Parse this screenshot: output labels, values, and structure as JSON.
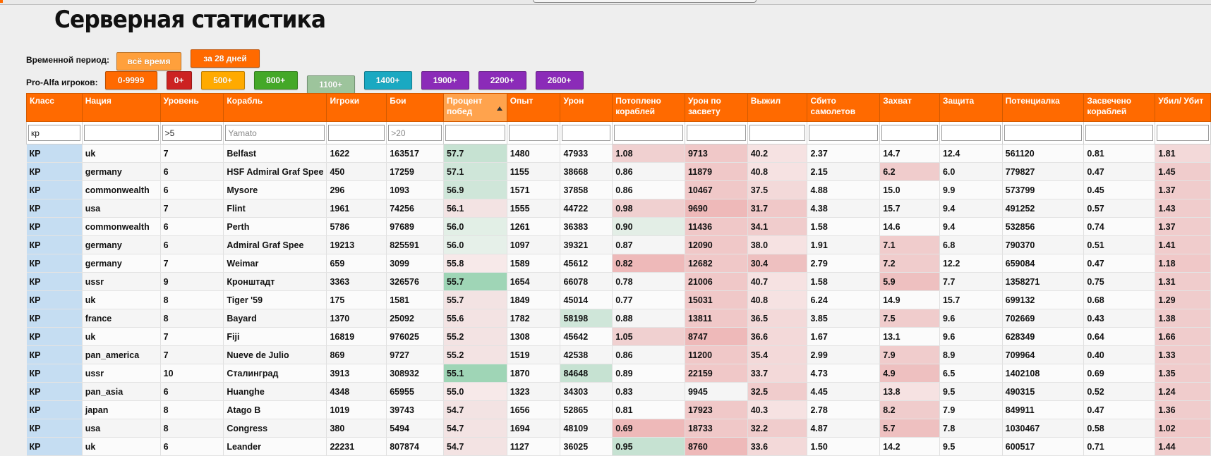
{
  "title": "Серверная статистика",
  "period": {
    "label": "Временной период:",
    "buttons": [
      {
        "label": "всё время",
        "color": "#ffa03c"
      },
      {
        "label": "за 28 дней",
        "color": "#ff6a00"
      }
    ]
  },
  "players": {
    "label": "Pro-Alfa игроков:",
    "buttons": [
      {
        "label": "0-9999",
        "color": "#ff6a00"
      },
      {
        "label": "0+",
        "color": "#cc2222"
      },
      {
        "label": "500+",
        "color": "#ffaa00"
      },
      {
        "label": "800+",
        "color": "#44a828"
      },
      {
        "label": "1100+",
        "color": "#9dc49c"
      },
      {
        "label": "1400+",
        "color": "#1aa9c2"
      },
      {
        "label": "1900+",
        "color": "#8b2bb8"
      },
      {
        "label": "2200+",
        "color": "#8b2bb8"
      },
      {
        "label": "2600+",
        "color": "#8b2bb8"
      }
    ]
  },
  "columns": [
    "Класс",
    "Нация",
    "Уровень",
    "Корабль",
    "Игроки",
    "Бои",
    "Процент побед",
    "Опыт",
    "Урон",
    "Потоплено кораблей",
    "Урон по засвету",
    "Выжил",
    "Сбито самолетов",
    "Захват",
    "Защита",
    "Потенциалка",
    "Засвечено кораблей",
    "Убил/ Убит"
  ],
  "sorted_column": 6,
  "filters": {
    "values": [
      "кр",
      "",
      ">5",
      "",
      "",
      "",
      "",
      "",
      "",
      "",
      "",
      "",
      "",
      "",
      "",
      "",
      "",
      ""
    ],
    "placeholders": [
      "",
      "",
      "",
      "Yamato",
      "",
      ">20",
      "",
      "",
      "",
      "",
      "",
      "",
      "",
      "",
      "",
      "",
      "",
      ""
    ]
  },
  "rows": [
    [
      "КР",
      "uk",
      "7",
      "Belfast",
      "1622",
      "163517",
      "57.7",
      "1480",
      "47933",
      "1.08",
      "9713",
      "40.2",
      "2.37",
      "14.7",
      "12.4",
      "561120",
      "0.81",
      "1.81"
    ],
    [
      "КР",
      "germany",
      "6",
      "HSF Admiral Graf Spee",
      "450",
      "17259",
      "57.1",
      "1155",
      "38668",
      "0.86",
      "11879",
      "40.8",
      "2.15",
      "6.2",
      "6.0",
      "779827",
      "0.47",
      "1.45"
    ],
    [
      "КР",
      "commonwealth",
      "6",
      "Mysore",
      "296",
      "1093",
      "56.9",
      "1571",
      "37858",
      "0.86",
      "10467",
      "37.5",
      "4.88",
      "15.0",
      "9.9",
      "573799",
      "0.45",
      "1.37"
    ],
    [
      "КР",
      "usa",
      "7",
      "Flint",
      "1961",
      "74256",
      "56.1",
      "1555",
      "44722",
      "0.98",
      "9690",
      "31.7",
      "4.38",
      "15.7",
      "9.4",
      "491252",
      "0.57",
      "1.43"
    ],
    [
      "КР",
      "commonwealth",
      "6",
      "Perth",
      "5786",
      "97689",
      "56.0",
      "1261",
      "36383",
      "0.90",
      "11436",
      "34.1",
      "1.58",
      "14.6",
      "9.4",
      "532856",
      "0.74",
      "1.37"
    ],
    [
      "КР",
      "germany",
      "6",
      "Admiral Graf Spee",
      "19213",
      "825591",
      "56.0",
      "1097",
      "39321",
      "0.87",
      "12090",
      "38.0",
      "1.91",
      "7.1",
      "6.8",
      "790370",
      "0.51",
      "1.41"
    ],
    [
      "КР",
      "germany",
      "7",
      "Weimar",
      "659",
      "3099",
      "55.8",
      "1589",
      "45612",
      "0.82",
      "12682",
      "30.4",
      "2.79",
      "7.2",
      "12.2",
      "659084",
      "0.47",
      "1.18"
    ],
    [
      "КР",
      "ussr",
      "9",
      "Кронштадт",
      "3363",
      "326576",
      "55.7",
      "1654",
      "66078",
      "0.78",
      "21006",
      "40.7",
      "1.58",
      "5.9",
      "7.7",
      "1358271",
      "0.75",
      "1.31"
    ],
    [
      "КР",
      "uk",
      "8",
      "Tiger '59",
      "175",
      "1581",
      "55.7",
      "1849",
      "45014",
      "0.77",
      "15031",
      "40.8",
      "6.24",
      "14.9",
      "15.7",
      "699132",
      "0.68",
      "1.29"
    ],
    [
      "КР",
      "france",
      "8",
      "Bayard",
      "1370",
      "25092",
      "55.6",
      "1782",
      "58198",
      "0.88",
      "13811",
      "36.5",
      "3.85",
      "7.5",
      "9.6",
      "702669",
      "0.43",
      "1.38"
    ],
    [
      "КР",
      "uk",
      "7",
      "Fiji",
      "16819",
      "976025",
      "55.2",
      "1308",
      "45642",
      "1.05",
      "8747",
      "36.6",
      "1.67",
      "13.1",
      "9.6",
      "628349",
      "0.64",
      "1.66"
    ],
    [
      "КР",
      "pan_america",
      "7",
      "Nueve de Julio",
      "869",
      "9727",
      "55.2",
      "1519",
      "42538",
      "0.86",
      "11200",
      "35.4",
      "2.99",
      "7.9",
      "8.9",
      "709964",
      "0.40",
      "1.33"
    ],
    [
      "КР",
      "ussr",
      "10",
      "Сталинград",
      "3913",
      "308932",
      "55.1",
      "1870",
      "84648",
      "0.89",
      "22159",
      "33.7",
      "4.73",
      "4.9",
      "6.5",
      "1402108",
      "0.69",
      "1.35"
    ],
    [
      "КР",
      "pan_asia",
      "6",
      "Huanghe",
      "4348",
      "65955",
      "55.0",
      "1323",
      "34303",
      "0.83",
      "9945",
      "32.5",
      "4.45",
      "13.8",
      "9.5",
      "490315",
      "0.52",
      "1.24"
    ],
    [
      "КР",
      "japan",
      "8",
      "Atago B",
      "1019",
      "39743",
      "54.7",
      "1656",
      "52865",
      "0.81",
      "17923",
      "40.3",
      "2.78",
      "8.2",
      "7.9",
      "849911",
      "0.47",
      "1.36"
    ],
    [
      "КР",
      "usa",
      "8",
      "Congress",
      "380",
      "5494",
      "54.7",
      "1694",
      "48109",
      "0.69",
      "18733",
      "32.2",
      "4.87",
      "5.7",
      "7.8",
      "1030467",
      "0.58",
      "1.02"
    ],
    [
      "КР",
      "uk",
      "6",
      "Leander",
      "22231",
      "807874",
      "54.7",
      "1127",
      "36025",
      "0.95",
      "8760",
      "33.6",
      "1.50",
      "14.2",
      "9.5",
      "600517",
      "0.71",
      "1.44"
    ]
  ],
  "cell_colors": {
    "win_rate": [
      "#c6e2d2",
      "#cfe6d9",
      "#cfe6d9",
      "#f3e3e3",
      "#e2efe6",
      "#e6f0e9",
      "#f7e9e9",
      "#9fd5b6",
      "#f3e3e3",
      "#f3e3e3",
      "#f3e3e3",
      "#f3e3e3",
      "#9fd5b6",
      "#f7e9e9",
      "#f3e3e3",
      "#f3e3e3",
      "#f3e3e3"
    ],
    "damage": [
      "",
      "",
      "",
      "",
      "",
      "",
      "",
      "",
      "",
      "#cfe6d9",
      "",
      "",
      "#c6e2d2",
      "",
      "",
      "",
      ""
    ],
    "kills": [
      "#f0d0d0",
      "",
      "",
      "#f0d0d0",
      "#e3eee6",
      "",
      "#eeb9b9",
      "",
      "",
      "",
      "#f0d0d0",
      "",
      "",
      "",
      "",
      "#eeb9b9",
      "#c6e2d2"
    ],
    "spotting_damage": [
      "#f0c8c8",
      "#f0c8c8",
      "#f0c8c8",
      "#eeb9b9",
      "#f0c8c8",
      "#f0c8c8",
      "#f0c8c8",
      "#f0c8c8",
      "#f0c8c8",
      "#f0c8c8",
      "#eeb9b9",
      "#f0c8c8",
      "#f0c8c8",
      "",
      "#f0c8c8",
      "#f0c8c8",
      "#eeb9b9"
    ],
    "survived": [
      "#f6e2e2",
      "#f6e2e2",
      "#f3d9d9",
      "#f0c8c8",
      "#f0cccc",
      "#f6e2e2",
      "#eec0c0",
      "#f6e2e2",
      "#f6e2e2",
      "#f3d9d9",
      "#f3d9d9",
      "#f3d9d9",
      "#f3d9d9",
      "#f0cccc",
      "#f6e2e2",
      "#f0cccc",
      "#f3d9d9"
    ],
    "capture": [
      "",
      "#f0cccc",
      "",
      "",
      "",
      "#f0cccc",
      "#f0cccc",
      "#eec0c0",
      "",
      "#f0cccc",
      "",
      "#f0cccc",
      "#eec0c0",
      "#f6e2e2",
      "#f0cccc",
      "#eec0c0",
      ""
    ],
    "kd": [
      "#f3d9d9",
      "#f0cccc",
      "#f0cccc",
      "#f0cccc",
      "#f0cccc",
      "#f0cccc",
      "#f0c8c8",
      "#f0cccc",
      "#f0cccc",
      "#f0cccc",
      "#f0cccc",
      "#f0cccc",
      "#f0cccc",
      "#f0cccc",
      "#f0cccc",
      "#f0c8c8",
      "#f0cccc"
    ]
  }
}
